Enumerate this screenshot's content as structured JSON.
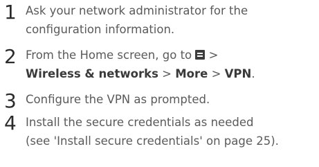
{
  "steps": [
    {
      "number": "1",
      "lines": [
        "Ask your network administrator for the",
        "configuration information."
      ]
    },
    {
      "number": "2",
      "line1_before_icon": "From the Home screen, go to",
      "line1_after_icon": ">",
      "path": {
        "item1": "Wireless & networks",
        "sep1": ">",
        "item2": "More",
        "sep2": ">",
        "item3": "VPN",
        "end": "."
      },
      "icon": "menu-icon"
    },
    {
      "number": "3",
      "lines": [
        "Configure the VPN as prompted."
      ]
    },
    {
      "number": "4",
      "lines": [
        "Install the secure credentials as needed",
        "(see 'Install secure credentials' on page 25)."
      ]
    }
  ]
}
